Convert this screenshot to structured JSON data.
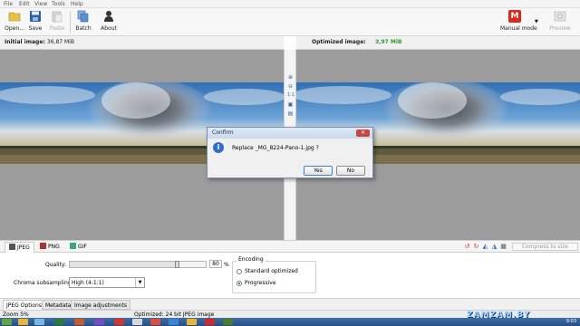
{
  "menu": [
    "File",
    "Edit",
    "View",
    "Tools",
    "Help"
  ],
  "toolbar": {
    "open": "Open...",
    "save": "Save",
    "paste": "Paste",
    "batch": "Batch",
    "about": "About",
    "mode": "Manual mode",
    "preview": "Preview"
  },
  "initial": {
    "label": "Initial image:",
    "size": "36,87 MiB"
  },
  "optimized": {
    "label": "Optimized image:",
    "size": "3,97 MiB",
    "size_color": "#2e9a2e"
  },
  "dialog": {
    "title": "Confirm",
    "message": "Replace _MG_8224-Pano-1.jpg ?",
    "yes": "Yes",
    "no": "No"
  },
  "formats": [
    "JPEG",
    "PNG",
    "GIF"
  ],
  "compress_button": "Compress to size",
  "options": {
    "quality_label": "Quality:",
    "quality_value": "80",
    "quality_unit": "%",
    "quality_fraction": 0.8,
    "chroma_label": "Chroma subsampling:",
    "chroma_value": "High (4:1:1)",
    "encoding_label": "Encoding",
    "standard": "Standard optimized",
    "progressive": "Progressive"
  },
  "bottom_tabs": [
    "JPEG Options",
    "Metadata",
    "Image adjustments"
  ],
  "status": {
    "zoom": "Zoom 5%",
    "info": "Optimized: 24 bit JPEG image"
  },
  "watermark": "ZAMZAM.BY",
  "clock": "9:03",
  "colors": {
    "accent": "#2b62a8",
    "mode_icon": "#d9291c",
    "taskbar": "#2f5f98"
  }
}
